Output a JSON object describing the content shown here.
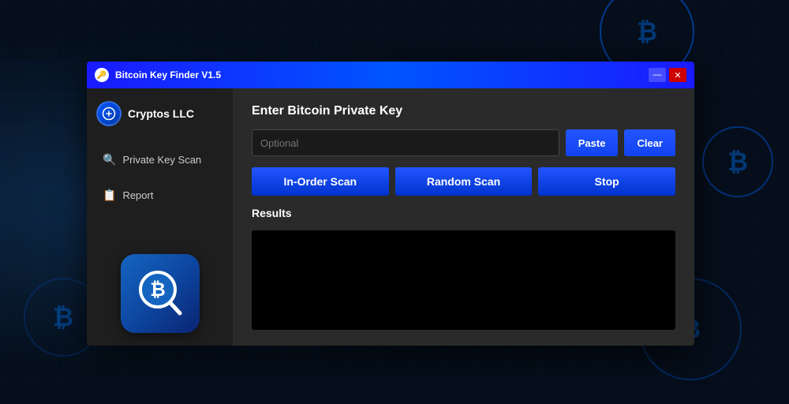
{
  "background": {
    "circles": [
      {
        "label": "₿",
        "class": "bc1"
      },
      {
        "label": "₿",
        "class": "bc2"
      },
      {
        "label": "₿",
        "class": "bc3"
      },
      {
        "label": "₿",
        "class": "bc4"
      },
      {
        "label": "₿",
        "class": "bc5"
      }
    ]
  },
  "titlebar": {
    "title": "Bitcoin Key Finder V1.5",
    "icon": "🔑",
    "minimize_label": "—",
    "close_label": "✕"
  },
  "sidebar": {
    "brand_name": "Cryptos LLC",
    "nav_items": [
      {
        "label": "Private Key Scan",
        "icon": "🔍"
      },
      {
        "label": "Report",
        "icon": "📋"
      }
    ]
  },
  "main": {
    "section_title": "Enter Bitcoin Private Key",
    "input_placeholder": "Optional",
    "paste_label": "Paste",
    "clear_label": "Clear",
    "scan_buttons": [
      {
        "label": "In-Order Scan"
      },
      {
        "label": "Random Scan"
      },
      {
        "label": "Stop"
      }
    ],
    "results_title": "Results"
  }
}
